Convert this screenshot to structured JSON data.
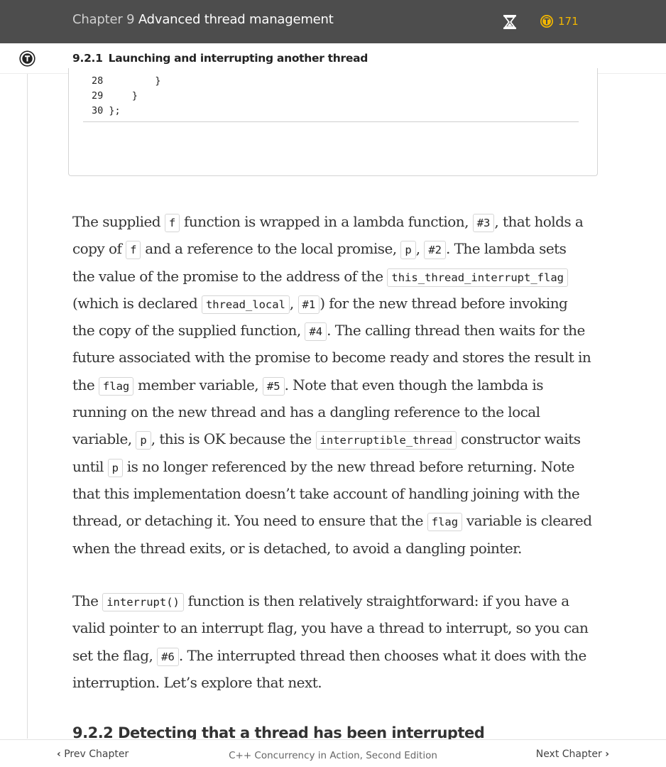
{
  "header": {
    "chapter_number": "Chapter 9",
    "chapter_title": "Advanced thread management",
    "token_count": "171"
  },
  "section": {
    "number": "9.2.1",
    "title": "Launching and interrupting another thread"
  },
  "code": {
    "lines": [
      {
        "num": "28",
        "text": "        }"
      },
      {
        "num": "29",
        "text": "    }"
      },
      {
        "num": "30",
        "text": "};"
      }
    ]
  },
  "paragraph1": [
    [
      "The supplied ",
      {
        "c": "f"
      },
      " function is wrapped in a lambda function, ",
      {
        "c": "#3"
      },
      ", that holds a"
    ],
    [
      "copy of ",
      {
        "c": "f"
      },
      " and a reference to the local promise, ",
      {
        "c": "p"
      },
      ", ",
      {
        "c": "#2"
      },
      ". The lambda sets"
    ],
    [
      "the value of the promise to the address of the ",
      {
        "c": "this_thread_interrupt_flag"
      }
    ],
    [
      "(which is declared ",
      {
        "c": "thread_local"
      },
      ", ",
      {
        "c": "#1"
      },
      ") for the new thread before invoking"
    ],
    [
      "the copy of the supplied function, ",
      {
        "c": "#4"
      },
      ". The calling thread then waits for the"
    ],
    [
      "future associated with the promise to become ready and stores the result in"
    ],
    [
      "the ",
      {
        "c": "flag"
      },
      " member variable, ",
      {
        "c": "#5"
      },
      ". Note that even though the lambda is"
    ],
    [
      "running on the new thread and has a dangling reference to the local"
    ],
    [
      "variable, ",
      {
        "c": "p"
      },
      ", this is OK because the ",
      {
        "c": "interruptible_thread"
      },
      " constructor waits"
    ],
    [
      "until ",
      {
        "c": "p"
      },
      " is no longer referenced by the new thread before returning. Note"
    ],
    [
      "that this implementation doesn’t take account of handling joining with the"
    ],
    [
      "thread, or detaching it. You need to ensure that the ",
      {
        "c": "flag"
      },
      " variable is cleared"
    ],
    [
      "when the thread exits, or is detached, to avoid a dangling pointer."
    ]
  ],
  "paragraph2": [
    [
      "The ",
      {
        "c": "interrupt()"
      },
      " function is then relatively straightforward: if you have a"
    ],
    [
      "valid pointer to an interrupt flag, you have a thread to interrupt, so you can"
    ],
    [
      "set the flag, ",
      {
        "c": "#6"
      },
      ". The interrupted thread then chooses what it does with the"
    ],
    [
      "interruption. Let’s explore that next."
    ]
  ],
  "next_heading": "9.2.2   Detecting that a thread has been interrupted",
  "footer": {
    "prev_label": "Prev Chapter",
    "book_title": "C++ Concurrency in Action, Second Edition",
    "next_label": "Next Chapter"
  },
  "icons": {
    "timer": "hourglass-icon",
    "tokens": "token-coin-icon",
    "toc": "toc-circle-icon",
    "prev": "chevron-left-icon",
    "next": "chevron-right-icon"
  },
  "colors": {
    "topbar": "#4d4d4d",
    "token": "#f2b600"
  }
}
